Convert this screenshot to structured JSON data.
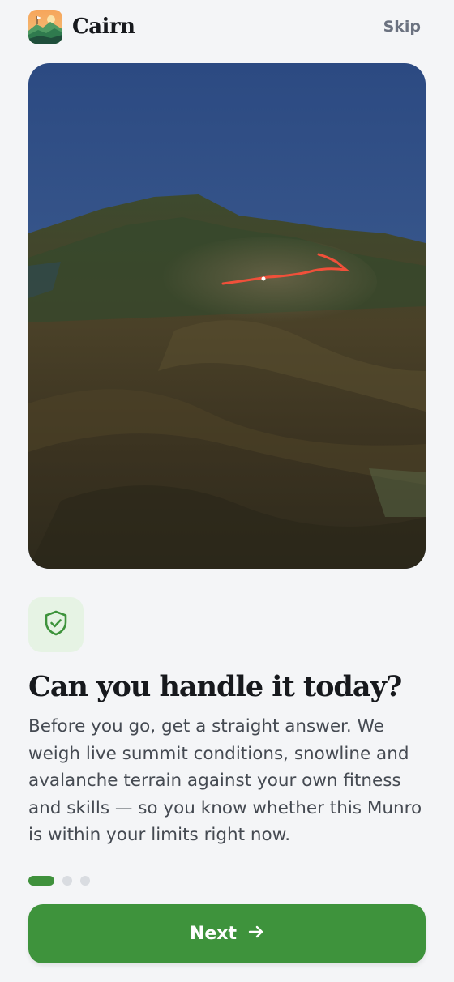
{
  "app": {
    "name": "Cairn"
  },
  "header": {
    "skip_label": "Skip"
  },
  "onboarding": {
    "title": "Can you handle it today?",
    "body": "Before you go, get a straight answer. We weigh live summit conditions, snowline and avalanche terrain against your own fitness and skills — so you know whether this Munro is within your limits right now.",
    "step_current": 1,
    "step_total": 3
  },
  "cta": {
    "next_label": "Next"
  },
  "colors": {
    "accent": "#3e933c",
    "badge_bg": "#e6f3e4",
    "route": "#f0503a"
  },
  "icons": {
    "logo": "mountain-logo-icon",
    "feature": "shield-check-icon",
    "next": "arrow-right-icon"
  }
}
